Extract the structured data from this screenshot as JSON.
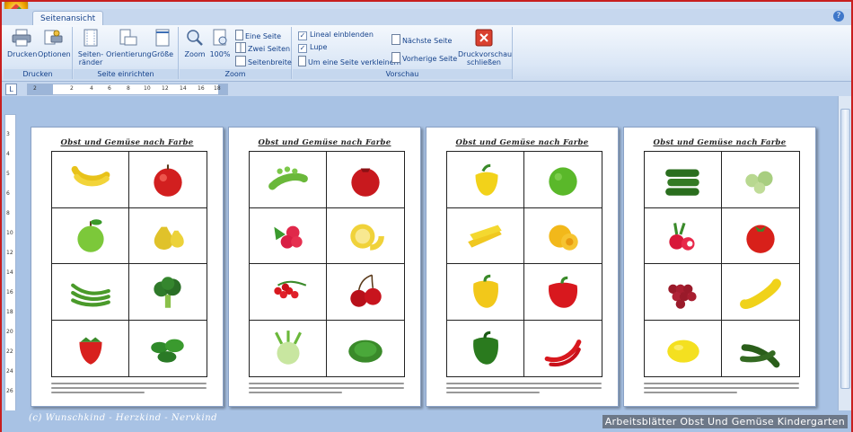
{
  "ribbon": {
    "tab": "Seitenansicht",
    "groups": {
      "drucken": {
        "label": "Drucken",
        "buttons": {
          "print": "Drucken",
          "options": "Optionen"
        }
      },
      "seite": {
        "label": "Seite einrichten",
        "margins_l1": "Seiten-",
        "margins_l2": "ränder",
        "orientation": "Orientierung",
        "size": "Größe"
      },
      "zoom": {
        "label": "Zoom",
        "zoom": "Zoom",
        "hundred": "100%",
        "one_page": "Eine Seite",
        "two_pages": "Zwei Seiten",
        "page_width": "Seitenbreite"
      },
      "vorschau": {
        "label": "Vorschau",
        "ruler": "Lineal einblenden",
        "magnifier": "Lupe",
        "shrink": "Um eine Seite verkleinern",
        "next": "Nächste Seite",
        "prev": "Vorherige Seite",
        "close_l1": "Druckvorschau",
        "close_l2": "schließen"
      }
    }
  },
  "ruler": {
    "ticks": [
      "2",
      "2",
      "4",
      "6",
      "8",
      "10",
      "12",
      "14",
      "16",
      "18"
    ]
  },
  "vruler": {
    "ticks": [
      "3",
      "4",
      "5",
      "6",
      "8",
      "10",
      "12",
      "14",
      "16",
      "18",
      "20",
      "22",
      "24",
      "26"
    ]
  },
  "pages": [
    {
      "title": "Obst und Gemüse nach Farbe",
      "items": [
        "banana",
        "red-apple",
        "green-apple",
        "pear",
        "green-beans",
        "broccoli",
        "strawberry",
        "lambs-lettuce"
      ]
    },
    {
      "title": "Obst und Gemüse nach Farbe",
      "items": [
        "peas",
        "pomegranate",
        "raspberry",
        "melon",
        "redcurrant",
        "cherry",
        "kohlrabi",
        "lettuce"
      ]
    },
    {
      "title": "Obst und Gemüse nach Farbe",
      "items": [
        "yellow-pepper-small",
        "lime",
        "corn",
        "apricot",
        "yellow-pepper",
        "red-pepper",
        "green-pepper",
        "chili"
      ]
    },
    {
      "title": "Obst und Gemüse nach Farbe",
      "items": [
        "cucumber",
        "gooseberry",
        "radish",
        "tomato",
        "grapes",
        "zucchini-yellow",
        "lemon",
        "zucchini-green"
      ]
    }
  ],
  "footer": {
    "credit": "(c) Wunschkind - Herzkind - Nervkind",
    "caption": "Arbeitsblätter Obst Und Gemüse Kindergarten"
  },
  "colors": {
    "accent": "#15428b",
    "frame": "#c81e1e",
    "workspace": "#a8c2e4"
  }
}
